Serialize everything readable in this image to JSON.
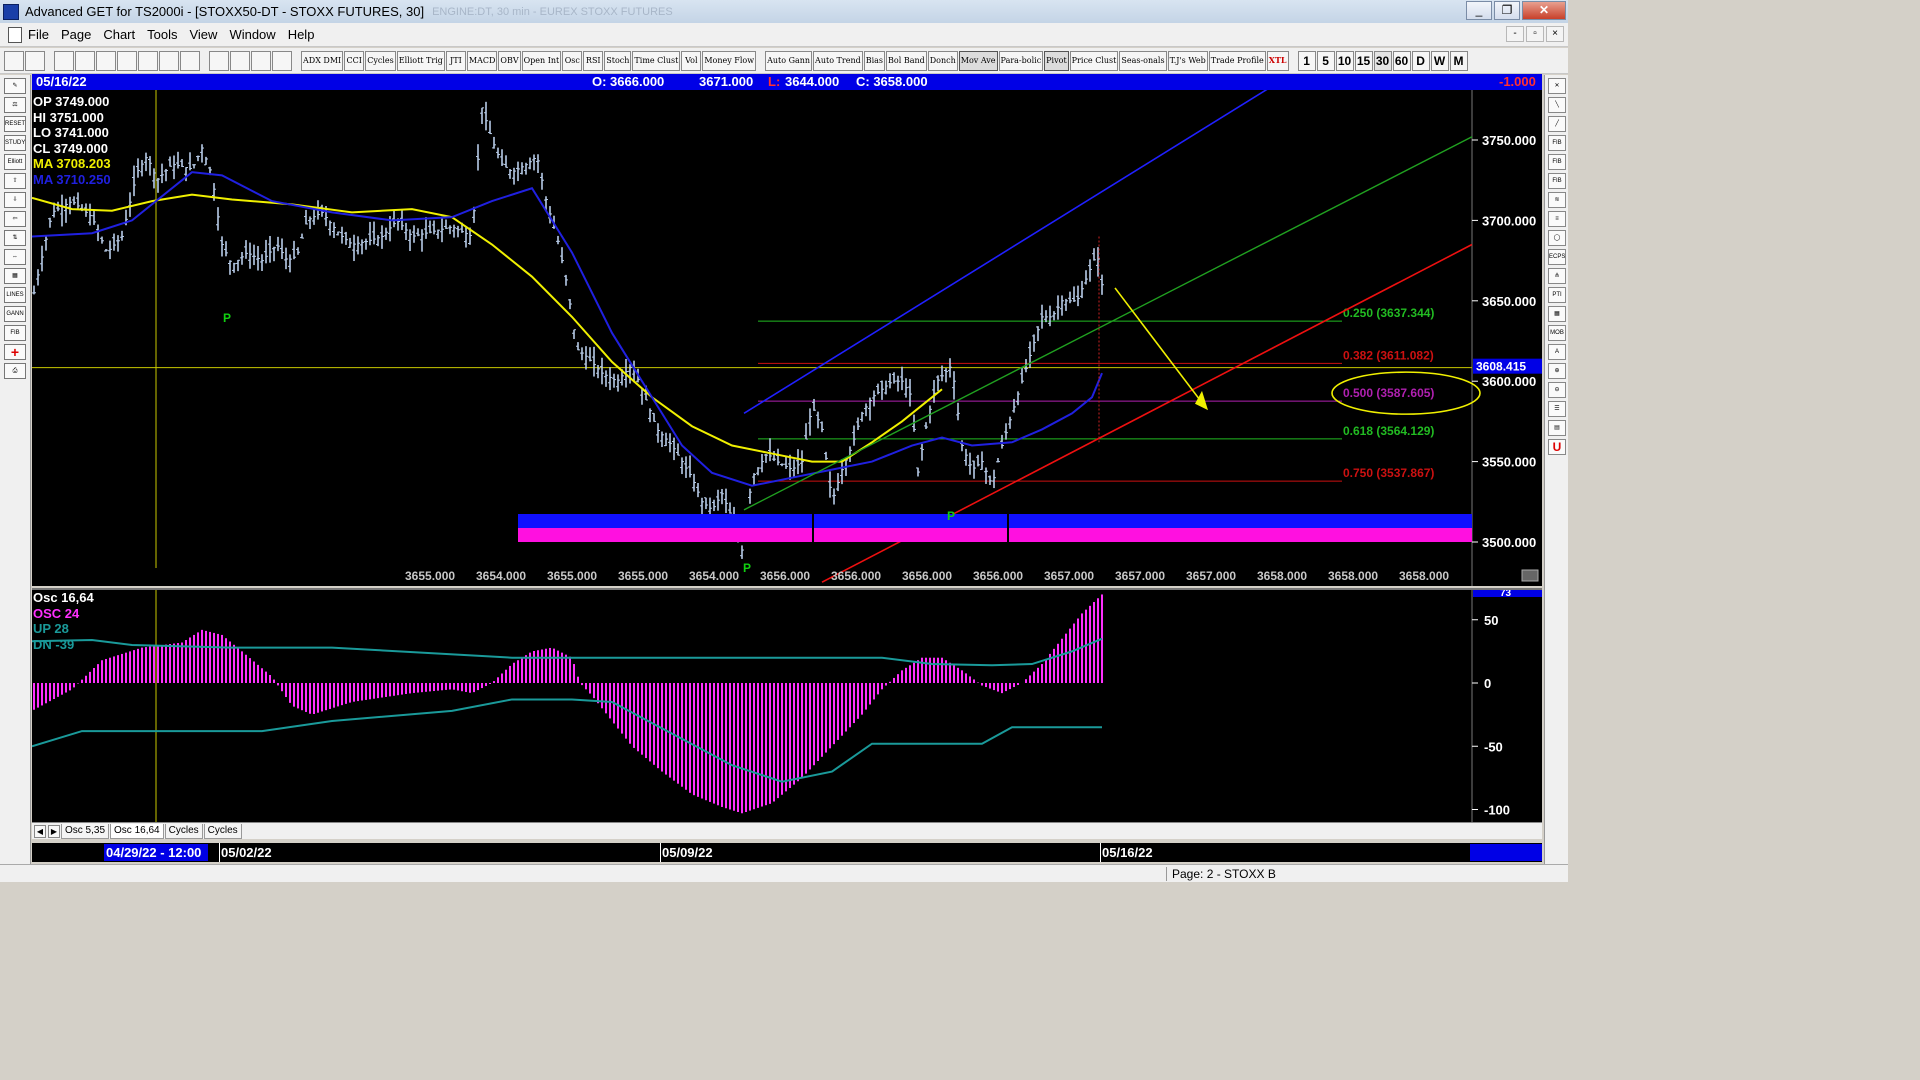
{
  "window": {
    "title": "Advanced GET for TS2000i - [STOXX50-DT - STOXX FUTURES, 30]",
    "ghost_title": "ENGINE:DT, 30 min - EUREX STOXX FUTURES",
    "min_glyph": "_",
    "max_glyph": "❐",
    "close_glyph": "✕",
    "mdi_min": "-",
    "mdi_restore": "▫",
    "mdi_close": "×"
  },
  "menu": [
    "File",
    "Page",
    "Chart",
    "Tools",
    "View",
    "Window",
    "Help"
  ],
  "toolbar": {
    "studies": [
      "ADX DMI",
      "CCI",
      "Cycles",
      "Elliott Trig",
      "JTI",
      "MACD",
      "OBV",
      "Open Int",
      "Osc",
      "RSI",
      "Stoch",
      "Time Clust",
      "Vol",
      "Money Flow"
    ],
    "studies2": [
      "Auto Gann",
      "Auto Trend",
      "Bias",
      "Bol Band",
      "Donch",
      "Mov Ave",
      "Para-bolic",
      "Pivot",
      "Price Clust",
      "Seas-onals",
      "T.J's Web",
      "Trade Profile",
      "XTL"
    ],
    "timeframes": [
      "1",
      "5",
      "10",
      "15",
      "30",
      "60",
      "D",
      "W",
      "M"
    ],
    "active_timeframe": "30"
  },
  "info_bar": {
    "date": "05/16/22",
    "open": "O: 3666.000",
    "high": "3671.000",
    "low_label": "L:",
    "low": "3644.000",
    "close": "C: 3658.000",
    "change": "-1.000"
  },
  "legend": {
    "op": "OP  3749.000",
    "hi": "HI   3751.000",
    "lo": "LO  3741.000",
    "cl": "CL  3749.000",
    "ma1": "MA  3708.203",
    "ma2": "MA  3710.250"
  },
  "colors": {
    "ma_yellow": "#f0f000",
    "ma_blue": "#2020e0",
    "fib_green": "#22bb22",
    "fib_red": "#cc1111",
    "fib_magenta": "#b020b0",
    "osc_magenta": "#ff30ff",
    "osc_teal": "#1a9a9a",
    "bars": "#b8cce8",
    "pivot_green": "#10d010"
  },
  "price_axis": {
    "ticks": [
      "3750.000",
      "3700.000",
      "3650.000",
      "3600.000",
      "3550.000",
      "3500.000"
    ],
    "current": "3608.415"
  },
  "fib_levels": [
    {
      "label": "0.250 (3637.344)",
      "color": "#22bb22"
    },
    {
      "label": "0.382 (3611.082)",
      "color": "#cc1111"
    },
    {
      "label": "0.500 (3587.605)",
      "color": "#b020b0"
    },
    {
      "label": "0.618 (3564.129)",
      "color": "#22bb22"
    },
    {
      "label": "0.750 (3537.867)",
      "color": "#cc1111"
    }
  ],
  "bottom_values": [
    "3655.000",
    "3654.000",
    "3655.000",
    "3655.000",
    "3654.000",
    "3656.000",
    "3656.000",
    "3656.000",
    "3656.000",
    "3657.000",
    "3657.000",
    "3657.000",
    "3658.000",
    "3658.000",
    "3658.000"
  ],
  "pivots": [
    "P",
    "P",
    "P"
  ],
  "osc": {
    "legend": [
      "Osc 16,64",
      "OSC 24",
      "UP   28",
      "DN   -39"
    ],
    "legend_colors": [
      "#ffffff",
      "#ff30ff",
      "#1a9a9a",
      "#1a9a9a"
    ],
    "axis_ticks": [
      "50",
      "0",
      "-50",
      "-100"
    ],
    "top_tag": "73"
  },
  "tabs": [
    "Osc 5,35",
    "Osc 16,64",
    "Cycles",
    "Cycles"
  ],
  "active_tab": "Osc 16,64",
  "time_axis": {
    "labels": [
      "04/29/22 - 12:00",
      "05/02/22",
      "05/09/22",
      "05/16/22"
    ]
  },
  "status": "Page: 2 - STOXX B"
}
